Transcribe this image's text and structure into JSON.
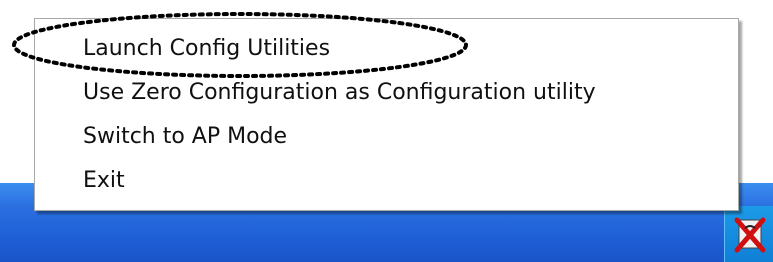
{
  "context_menu": {
    "items": [
      {
        "label": "Launch Config Utilities"
      },
      {
        "label": "Use Zero Configuration as Configuration utility"
      },
      {
        "label": "Switch to AP Mode"
      },
      {
        "label": "Exit"
      }
    ]
  },
  "tray": {
    "icon": "wireless-utility-icon"
  },
  "annotation": {
    "shape": "dotted-ellipse",
    "color": "#000000",
    "target": "Launch Config Utilities"
  },
  "colors": {
    "taskbar": "#2a6fe0",
    "tray": "#1c9be8",
    "menu_background": "#ffffff"
  }
}
